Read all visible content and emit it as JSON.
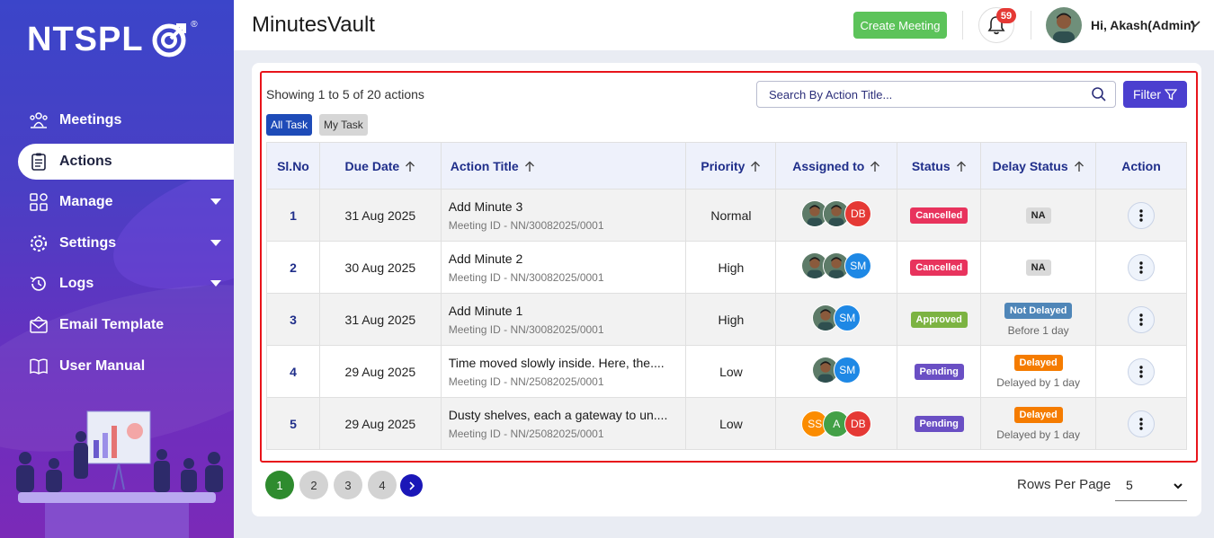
{
  "brand": {
    "logo_text": "NTSPL",
    "logo_reg": "®"
  },
  "sidebar": {
    "items": [
      {
        "label": "Meetings",
        "icon": "meetings-icon",
        "active": false,
        "has_caret": false
      },
      {
        "label": "Actions",
        "icon": "clipboard-icon",
        "active": true,
        "has_caret": false
      },
      {
        "label": "Manage",
        "icon": "manage-grid-icon",
        "active": false,
        "has_caret": true
      },
      {
        "label": "Settings",
        "icon": "gear-icon",
        "active": false,
        "has_caret": true
      },
      {
        "label": "Logs",
        "icon": "history-icon",
        "active": false,
        "has_caret": true
      },
      {
        "label": "Email Template",
        "icon": "email-icon",
        "active": false,
        "has_caret": false
      },
      {
        "label": "User Manual",
        "icon": "book-icon",
        "active": false,
        "has_caret": false
      }
    ]
  },
  "header": {
    "title": "MinutesVault",
    "create_button": "Create Meeting",
    "notification_count": "59",
    "user_greeting": "Hi, Akash(Admin)"
  },
  "main": {
    "showing_text": "Showing 1 to 5 of 20 actions",
    "search_placeholder": "Search By Action Title...",
    "filter_label": "Filter",
    "tabs": {
      "all": "All Task",
      "mine": "My Task"
    },
    "columns": [
      "Sl.No",
      "Due Date",
      "Action Title",
      "Priority",
      "Assigned to",
      "Status",
      "Delay Status",
      "Action"
    ],
    "rows": [
      {
        "slno": "1",
        "due": "31 Aug 2025",
        "title": "Add Minute 3",
        "meeting": "Meeting ID - NN/30082025/0001",
        "priority": "Normal",
        "assignees": [
          {
            "type": "photo"
          },
          {
            "type": "photo"
          },
          {
            "type": "initials",
            "text": "DB",
            "color": "#e53935"
          }
        ],
        "status": "Cancelled",
        "status_color": "#e8335d",
        "delay": "NA",
        "delay_type": "na",
        "delay_sub": ""
      },
      {
        "slno": "2",
        "due": "30 Aug 2025",
        "title": "Add Minute 2",
        "meeting": "Meeting ID - NN/30082025/0001",
        "priority": "High",
        "assignees": [
          {
            "type": "photo"
          },
          {
            "type": "photo"
          },
          {
            "type": "initials",
            "text": "SM",
            "color": "#1e88e5"
          }
        ],
        "status": "Cancelled",
        "status_color": "#e8335d",
        "delay": "NA",
        "delay_type": "na",
        "delay_sub": ""
      },
      {
        "slno": "3",
        "due": "31 Aug 2025",
        "title": "Add Minute 1",
        "meeting": "Meeting ID - NN/30082025/0001",
        "priority": "High",
        "assignees": [
          {
            "type": "photo"
          },
          {
            "type": "initials",
            "text": "SM",
            "color": "#1e88e5"
          }
        ],
        "status": "Approved",
        "status_color": "#7cb342",
        "delay": "Not Delayed",
        "delay_type": "pill",
        "delay_color": "#4f86b8",
        "delay_sub": "Before 1 day"
      },
      {
        "slno": "4",
        "due": "29 Aug 2025",
        "title": "Time moved slowly inside. Here, the....",
        "meeting": "Meeting ID - NN/25082025/0001",
        "priority": "Low",
        "assignees": [
          {
            "type": "photo"
          },
          {
            "type": "initials",
            "text": "SM",
            "color": "#1e88e5"
          }
        ],
        "status": "Pending",
        "status_color": "#6a4fc4",
        "delay": "Delayed",
        "delay_type": "pill",
        "delay_color": "#f57c00",
        "delay_sub": "Delayed by 1 day"
      },
      {
        "slno": "5",
        "due": "29 Aug 2025",
        "title": "Dusty shelves, each a gateway to un....",
        "meeting": "Meeting ID - NN/25082025/0001",
        "priority": "Low",
        "assignees": [
          {
            "type": "initials",
            "text": "SS",
            "color": "#fb8c00"
          },
          {
            "type": "initials",
            "text": "A",
            "color": "#43a047"
          },
          {
            "type": "initials",
            "text": "DB",
            "color": "#e53935"
          }
        ],
        "status": "Pending",
        "status_color": "#6a4fc4",
        "delay": "Delayed",
        "delay_type": "pill",
        "delay_color": "#f57c00",
        "delay_sub": "Delayed by 1 day"
      }
    ],
    "pagination": {
      "pages": [
        "1",
        "2",
        "3",
        "4"
      ],
      "current": "1"
    },
    "rows_per_page_label": "Rows Per Page",
    "rows_per_page_value": "5"
  },
  "colors": {
    "accent": "#4b3fcf",
    "highlight_border": "#e8141b",
    "sidebar_top": "#3b45c9",
    "sidebar_bottom": "#7b2ab8"
  }
}
